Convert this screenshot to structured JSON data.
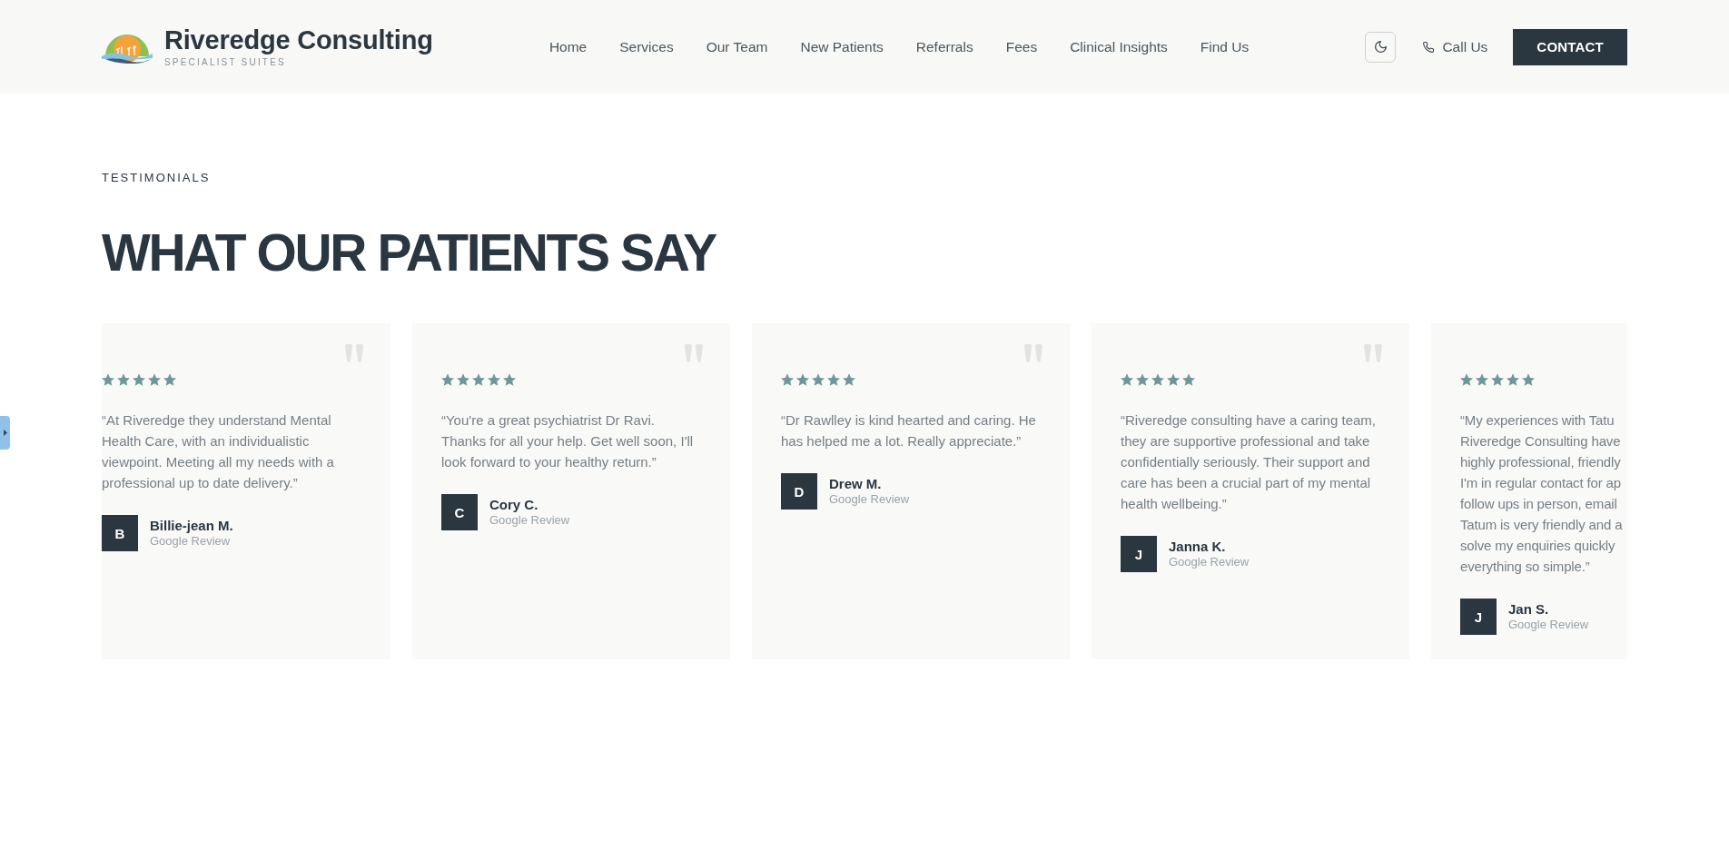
{
  "header": {
    "brand": {
      "name": "Riveredge Consulting",
      "tagline": "SPECIALIST SUITES"
    },
    "nav": [
      {
        "label": "Home"
      },
      {
        "label": "Services"
      },
      {
        "label": "Our Team"
      },
      {
        "label": "New Patients"
      },
      {
        "label": "Referrals"
      },
      {
        "label": "Fees"
      },
      {
        "label": "Clinical Insights"
      },
      {
        "label": "Find Us"
      }
    ],
    "call": {
      "label": "Call Us"
    },
    "contact_button": "CONTACT"
  },
  "testimonials": {
    "eyebrow": "TESTIMONIALS",
    "heading": "WHAT OUR PATIENTS SAY",
    "items": [
      {
        "stars": 5,
        "quote_mark": true,
        "quote": "“At Riveredge they understand Mental Health Care, with an individualistic viewpoint. Meeting all my needs with a professional up to date delivery.”",
        "initial": "B",
        "name": "Billie-jean M.",
        "source": "Google Review"
      },
      {
        "stars": 5,
        "quote_mark": true,
        "quote": "“You're a great psychiatrist Dr Ravi. Thanks for all your help. Get well soon, I'll look forward to your healthy return.”",
        "initial": "C",
        "name": "Cory C.",
        "source": "Google Review"
      },
      {
        "stars": 5,
        "quote_mark": true,
        "quote": "“Dr Rawlley is kind hearted and caring. He has helped me a lot. Really appreciate.”",
        "initial": "D",
        "name": "Drew M.",
        "source": "Google Review"
      },
      {
        "stars": 5,
        "quote_mark": true,
        "quote": "“Riveredge consulting have a caring team, they are supportive professional and take confidentially seriously. Their support and care has been a crucial part of my mental health wellbeing.”",
        "initial": "J",
        "name": "Janna K.",
        "source": "Google Review"
      },
      {
        "stars": 5,
        "quote_mark": false,
        "quote_lines": [
          "“My experiences with Tatu",
          "Riveredge Consulting have",
          "highly professional, friendly",
          "I'm in regular contact for ap",
          "follow ups in person, email",
          "Tatum is very friendly and a",
          "solve my enquiries quickly",
          "everything so simple.”"
        ],
        "initial": "J",
        "name": "Jan S.",
        "source": "Google Review"
      }
    ]
  }
}
